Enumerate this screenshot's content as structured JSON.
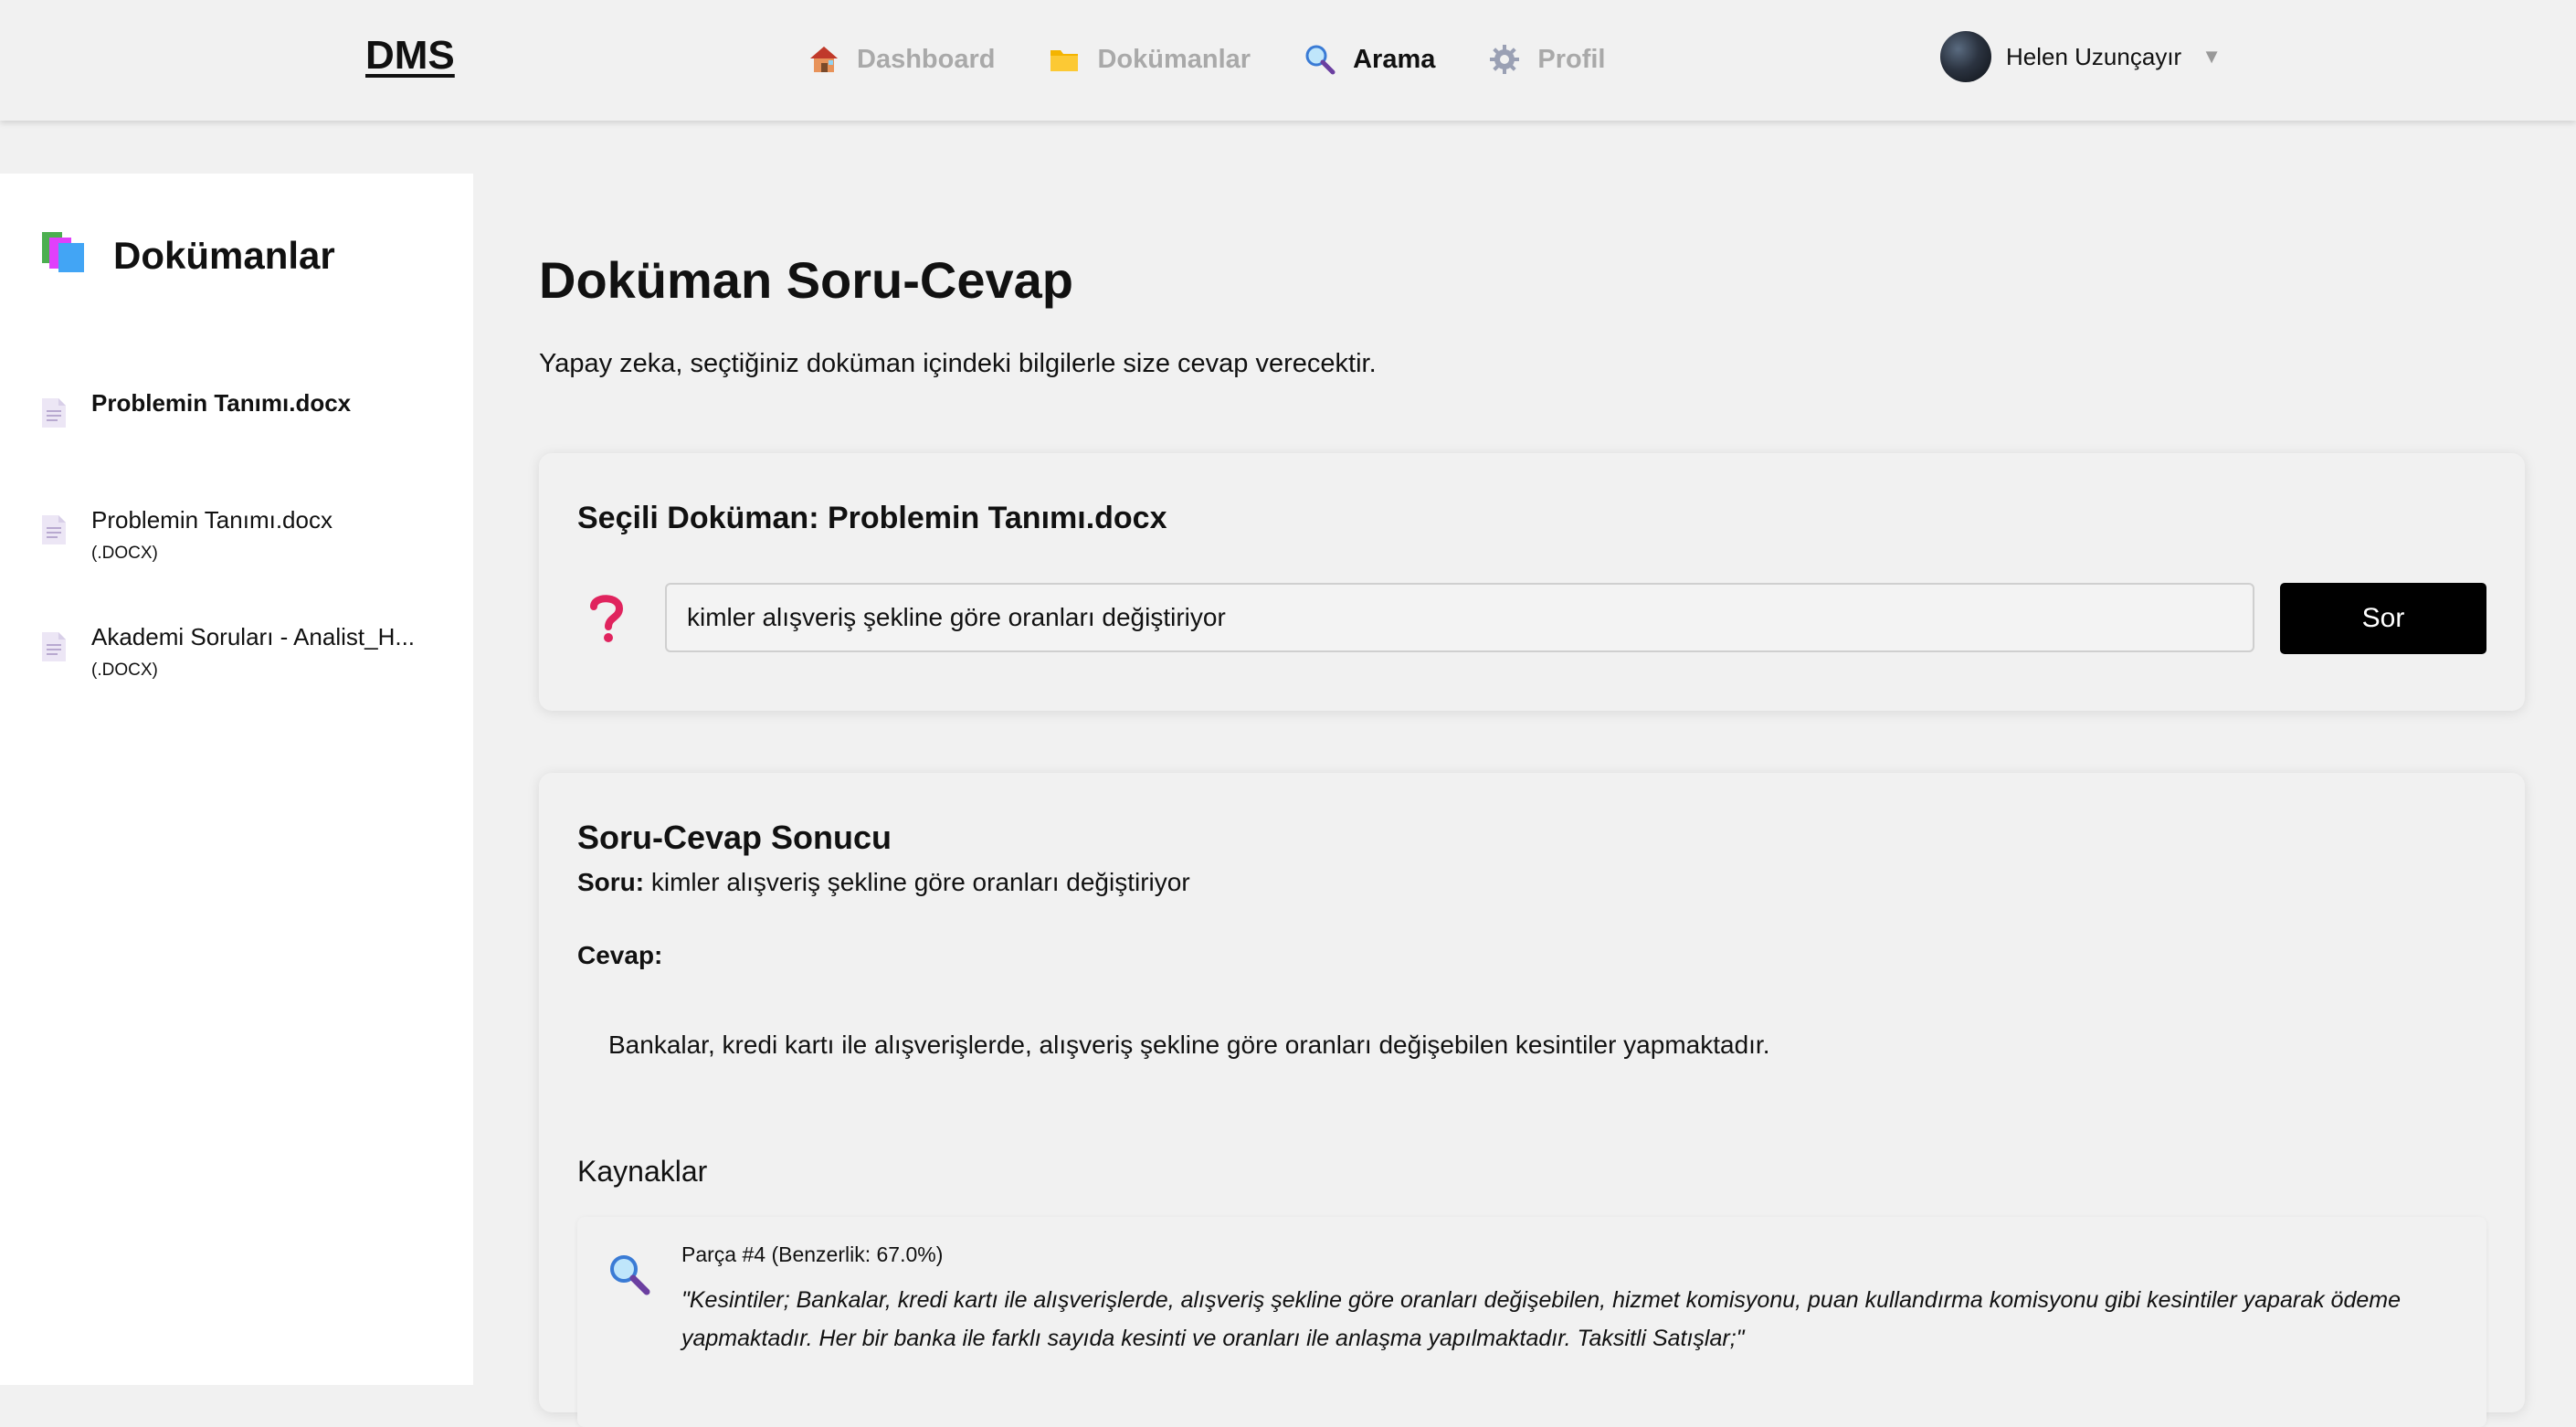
{
  "header": {
    "logo": "DMS",
    "nav": [
      {
        "label": "Dashboard",
        "icon": "house-icon",
        "active": false
      },
      {
        "label": "Dokümanlar",
        "icon": "folder-icon",
        "active": false
      },
      {
        "label": "Arama",
        "icon": "search-icon",
        "active": true
      },
      {
        "label": "Profil",
        "icon": "gear-icon",
        "active": false
      }
    ],
    "user": {
      "name": "Helen Uzunçayır",
      "caret": "▼"
    }
  },
  "sidebar": {
    "title": "Dokümanlar",
    "items": [
      {
        "name": "Problemin Tanımı.docx",
        "ext": "",
        "selected": true
      },
      {
        "name": "Problemin Tanımı.docx",
        "ext": "(.DOCX)",
        "selected": false
      },
      {
        "name": "Akademi Soruları - Analist_H...",
        "ext": "(.DOCX)",
        "selected": false
      }
    ]
  },
  "main": {
    "title": "Doküman Soru-Cevap",
    "subtitle": "Yapay zeka, seçtiğiniz doküman içindeki bilgilerle size cevap verecektir.",
    "query_card": {
      "selected_doc": "Seçili Doküman: Problemin Tanımı.docx",
      "input_value": "kimler alışveriş şekline göre oranları değiştiriyor",
      "button": "Sor"
    },
    "result": {
      "title": "Soru-Cevap Sonucu",
      "question_label": "Soru:",
      "question": "kimler alışveriş şekline göre oranları değiştiriyor",
      "answer_label": "Cevap:",
      "answer": "Bankalar, kredi kartı ile alışverişlerde, alışveriş şekline göre oranları değişebilen kesintiler yapmaktadır.",
      "sources_title": "Kaynaklar",
      "sources": [
        {
          "head": "Parça #4 (Benzerlik: 67.0%)",
          "text": "\"Kesintiler; Bankalar, kredi kartı ile alışverişlerde, alışveriş şekline göre oranları değişebilen, hizmet komisyonu, puan kullandırma komisyonu gibi kesintiler yaparak ödeme yapmaktadır. Her bir banka ile farklı sayıda kesinti ve oranları ile anlaşma yapılmaktadır.   Taksitli Satışlar;\""
        }
      ]
    }
  },
  "colors": {
    "accent": "#000000",
    "muted_nav": "#a9a9a9",
    "question_mark": "#e0245e"
  }
}
